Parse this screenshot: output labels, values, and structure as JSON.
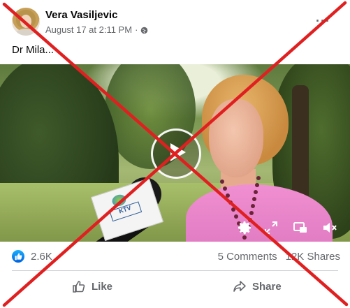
{
  "post": {
    "author_name": "Vera Vasiljevic",
    "timestamp": "August 17 at 2:11 PM",
    "separator": "·",
    "privacy_icon": "globe-icon",
    "more_label": "···",
    "caption": "Dr Mila..."
  },
  "video": {
    "mic_letters": "KTV",
    "controls": [
      "play-icon",
      "settings-icon",
      "fullscreen-icon",
      "picture-in-picture-icon",
      "mute-icon"
    ]
  },
  "stats": {
    "reaction_count": "2.6K",
    "comments": "5 Comments",
    "shares": "12K Shares"
  },
  "actions": {
    "like_label": "Like",
    "share_label": "Share"
  },
  "colors": {
    "accent": "#1877f2",
    "muted_text": "#65676b",
    "overlay_x": "#e02020"
  }
}
